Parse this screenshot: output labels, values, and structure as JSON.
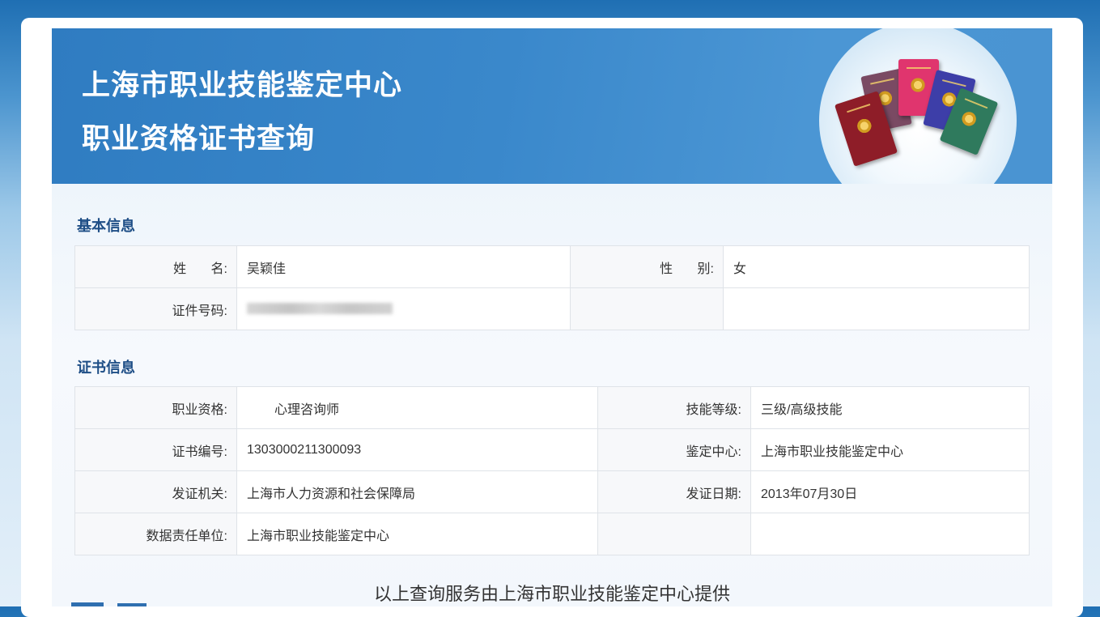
{
  "header": {
    "title_line1": "上海市职业技能鉴定中心",
    "title_line2": "职业资格证书查询"
  },
  "basic_info": {
    "section_title": "基本信息",
    "name_label": "姓 名:",
    "name_value": "吴颖佳",
    "gender_label": "性 别:",
    "gender_value": "女",
    "id_label": "证件号码:",
    "id_value_state": "blurred"
  },
  "certificate_info": {
    "section_title": "证书信息",
    "rows": [
      {
        "label1": "职业资格:",
        "value1": "心理咨询师",
        "label2": "技能等级:",
        "value2": "三级/高级技能"
      },
      {
        "label1": "证书编号:",
        "value1": "1303000211300093",
        "label2": "鉴定中心:",
        "value2": "上海市职业技能鉴定中心"
      },
      {
        "label1": "发证机关:",
        "value1": "上海市人力资源和社会保障局",
        "label2": "发证日期:",
        "value2": "2013年07月30日"
      },
      {
        "label1": "数据责任单位:",
        "value1": "上海市职业技能鉴定中心",
        "label2": "",
        "value2": ""
      }
    ]
  },
  "footer": {
    "text": "以上查询服务由上海市职业技能鉴定中心提供"
  },
  "colors": {
    "header_blue": "#3a88cb",
    "section_title": "#1e4e86",
    "table_border": "#dfe3e8",
    "label_bg": "#f7f8fa"
  },
  "icons": [
    "certificate-books-illustration"
  ]
}
